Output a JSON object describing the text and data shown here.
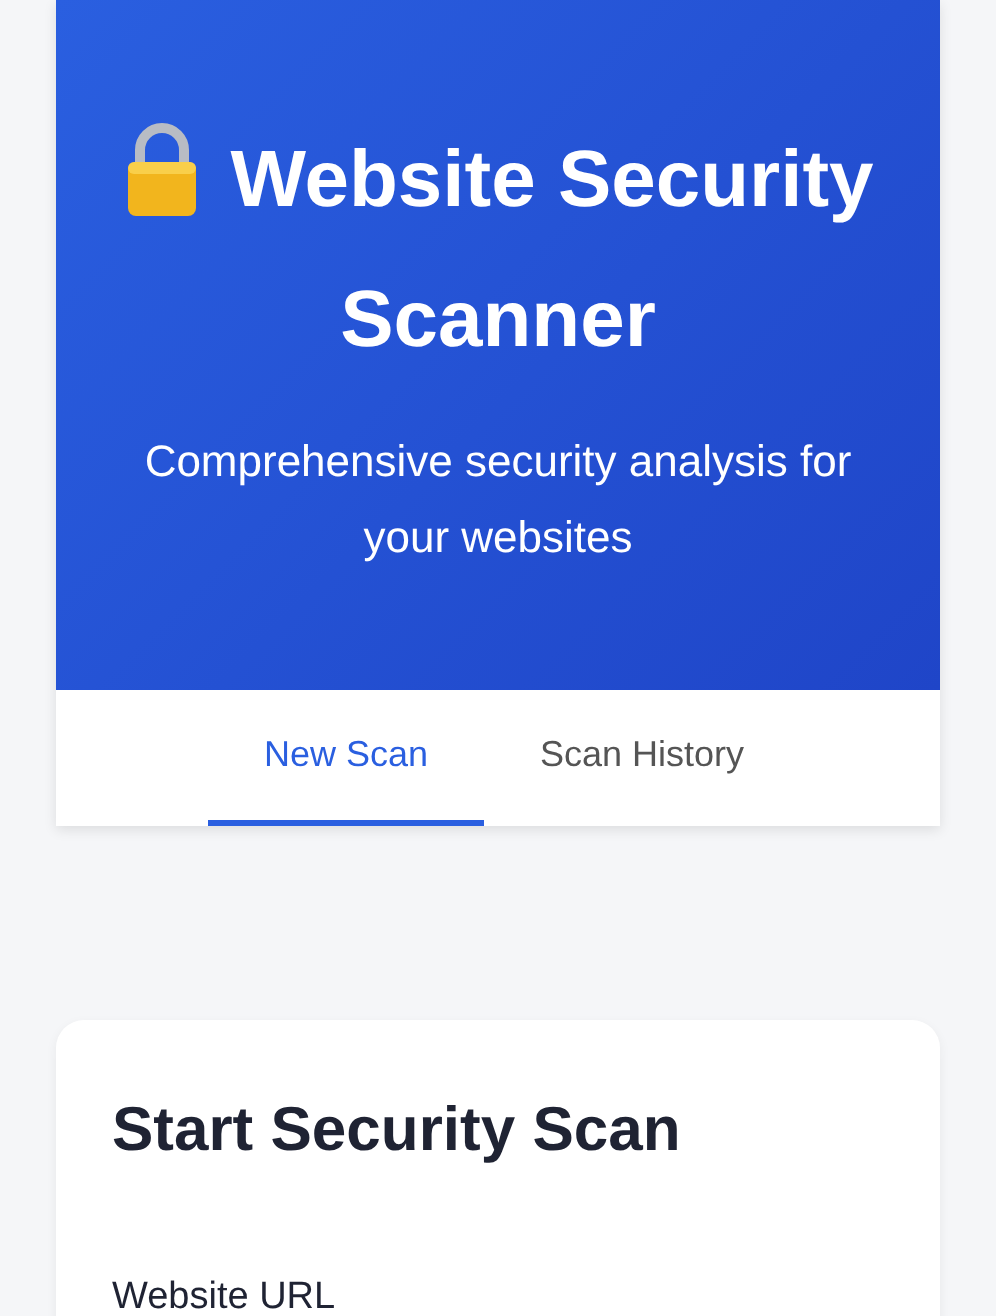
{
  "header": {
    "title": "Website Security Scanner",
    "subtitle": "Comprehensive security analysis for your websites"
  },
  "tabs": [
    {
      "label": "New Scan",
      "selected": true
    },
    {
      "label": "Scan History",
      "selected": false
    }
  ],
  "scan_card": {
    "title": "Start Security Scan",
    "url_label": "Website URL"
  }
}
